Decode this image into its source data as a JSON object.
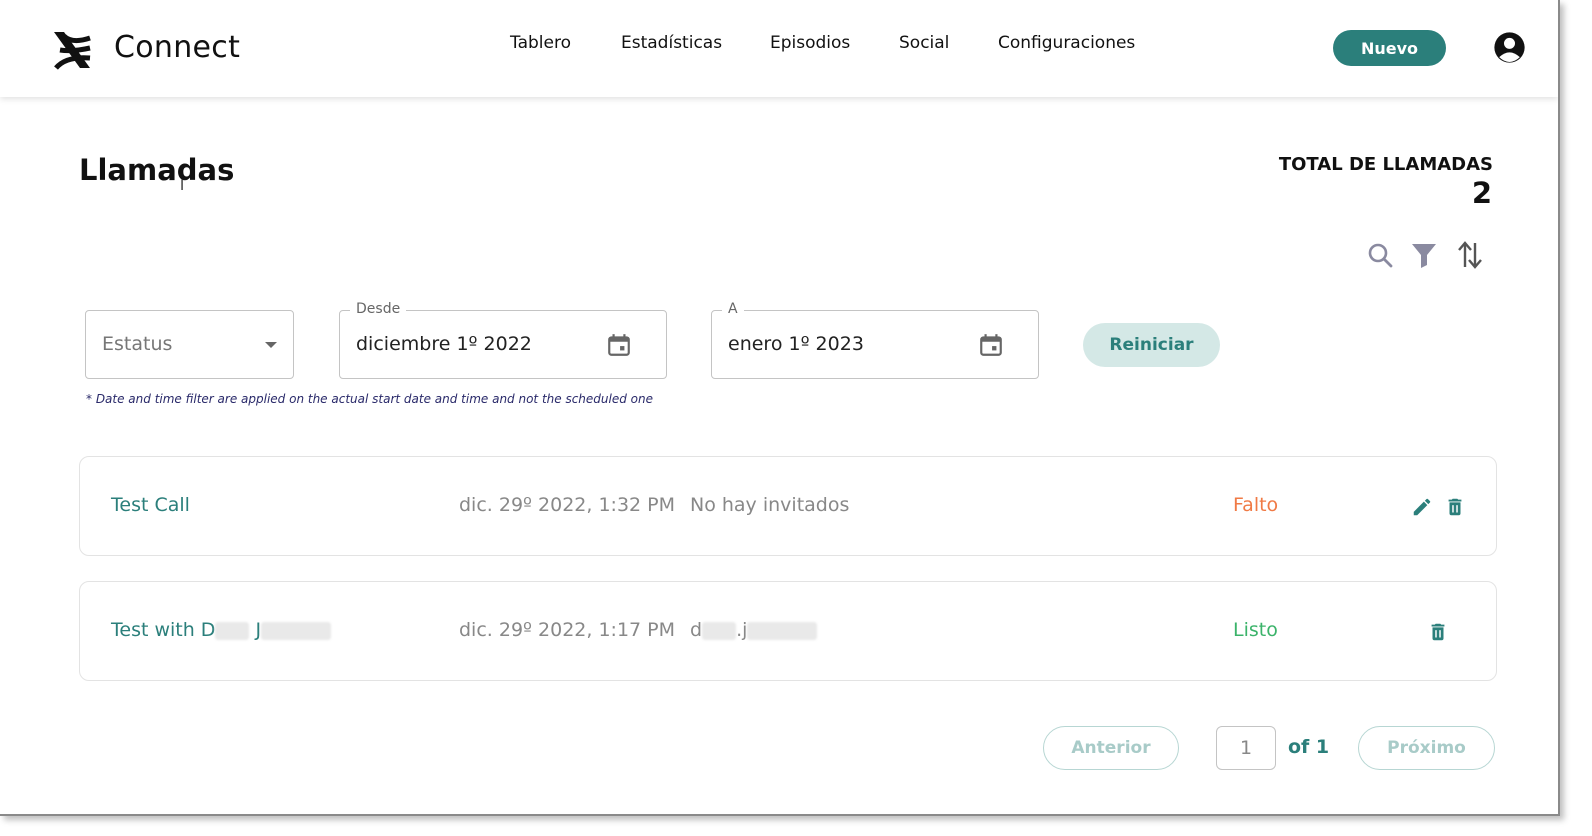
{
  "colors": {
    "accent": "#2b7f7b",
    "missed": "#f07a45",
    "done": "#3bb36a",
    "muted": "#888888"
  },
  "header": {
    "brand": "Connect",
    "nav": [
      "Tablero",
      "Estadísticas",
      "Episodios",
      "Social",
      "Configuraciones"
    ],
    "new_button": "Nuevo",
    "avatar_icon": "account-circle-icon",
    "logo_icon": "connect-logo-icon"
  },
  "main": {
    "title": "Llamadas",
    "total_label": "TOTAL DE LLAMADAS",
    "total_value": "2",
    "tools": [
      "search-icon",
      "filter-icon",
      "sort-icon"
    ]
  },
  "filters": {
    "status_placeholder": "Estatus",
    "from_label": "Desde",
    "from_value": "diciembre 1º 2022",
    "to_label": "A",
    "to_value": "enero 1º 2023",
    "reset_button": "Reiniciar",
    "note": "* Date and time filter are applied on the actual start date and time and not the scheduled one"
  },
  "calls": [
    {
      "title": "Test Call",
      "datetime": "dic. 29º 2022, 1:32 PM",
      "guests": "No hay invitados",
      "status": "Falto",
      "actions": [
        "edit-icon",
        "delete-icon"
      ]
    },
    {
      "title_prefix": "Test with D",
      "title_mid": "J",
      "datetime": "dic. 29º 2022, 1:17 PM",
      "guests_prefix": "d",
      "guests_mid": ".j",
      "status": "Listo",
      "actions": [
        "delete-icon"
      ]
    }
  ],
  "pagination": {
    "prev": "Anterior",
    "current_page": "1",
    "of_total": "of 1",
    "next": "Próximo"
  }
}
